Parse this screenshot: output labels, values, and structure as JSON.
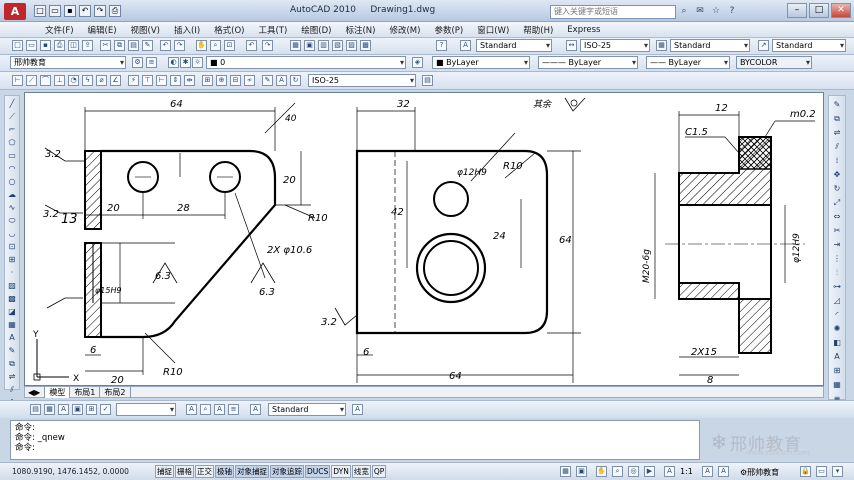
{
  "app": {
    "name": "AutoCAD 2010",
    "document": "Drawing1.dwg",
    "logo": "A"
  },
  "search": {
    "placeholder": "键入关键字或短语"
  },
  "menu": [
    "文件(F)",
    "编辑(E)",
    "视图(V)",
    "插入(I)",
    "格式(O)",
    "工具(T)",
    "绘图(D)",
    "标注(N)",
    "修改(M)",
    "参数(P)",
    "窗口(W)",
    "帮助(H)",
    "Express"
  ],
  "toolbar": {
    "text_style": "Standard",
    "dim_style": "ISO-25",
    "table_style": "Standard",
    "multileader_style": "Standard",
    "workspace": "邢帅教育",
    "layer": "0",
    "color": "ByLayer",
    "linetype": "ByLayer",
    "lineweight": "ByLayer",
    "plot_style": "BYCOLOR",
    "dim_style_2": "ISO-25"
  },
  "layout_tabs": [
    "模型",
    "布局1",
    "布局2"
  ],
  "style_row": {
    "text_style": "Standard"
  },
  "command": {
    "lines": [
      "命令:",
      "命令: _qnew",
      "命令:"
    ]
  },
  "status": {
    "coords": "1080.9190, 1476.1452, 0.0000",
    "toggles": [
      "捕捉",
      "栅格",
      "正交",
      "极轴",
      "对象捕捉",
      "对象追踪",
      "DUCS",
      "DYN",
      "线宽",
      "QP"
    ],
    "scale": "1:1",
    "workspace": "邢帅教育"
  },
  "branding": {
    "name": "邢帅教育",
    "url": "www.xsteach.com"
  },
  "drawing": {
    "view1": {
      "dims": [
        "64",
        "40",
        "28",
        "20",
        "20",
        "R10",
        "R10",
        "2X φ10.6",
        "φ15H9",
        "6",
        "20",
        "3.2",
        "3.2",
        "13",
        "6.3",
        "6.3"
      ]
    },
    "view2": {
      "dims": [
        "32",
        "φ12H9",
        "R10",
        "42",
        "24",
        "64",
        "6",
        "64",
        "3.2",
        "其余"
      ]
    },
    "view3": {
      "dims": [
        "12",
        "m0.2",
        "C1.5",
        "M20-6g",
        "φ12H9",
        "2X15",
        "8"
      ]
    },
    "ucs": {
      "x": "X",
      "y": "Y"
    }
  }
}
